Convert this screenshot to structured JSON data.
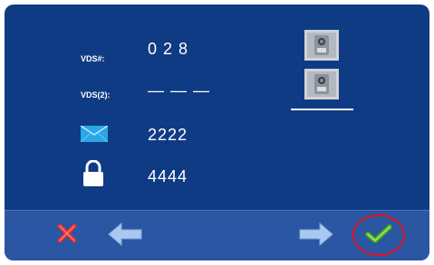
{
  "vds_label": "VDS#:",
  "vds_value": "0 2 8",
  "vds2_label": "VDS(2):",
  "vds2_value": "— — —",
  "mail_code": "2222",
  "lock_code": "4444",
  "icons": {
    "mail": "envelope-icon",
    "lock": "padlock-icon",
    "station": "door-station-icon",
    "cancel": "close-x-icon",
    "prev": "arrow-left-icon",
    "next": "arrow-right-icon",
    "confirm": "checkmark-icon"
  },
  "colors": {
    "background": "#0f3b84",
    "toolbar": "#2a56a3",
    "highlight": "#e0141a",
    "check": "#4caf2a"
  }
}
